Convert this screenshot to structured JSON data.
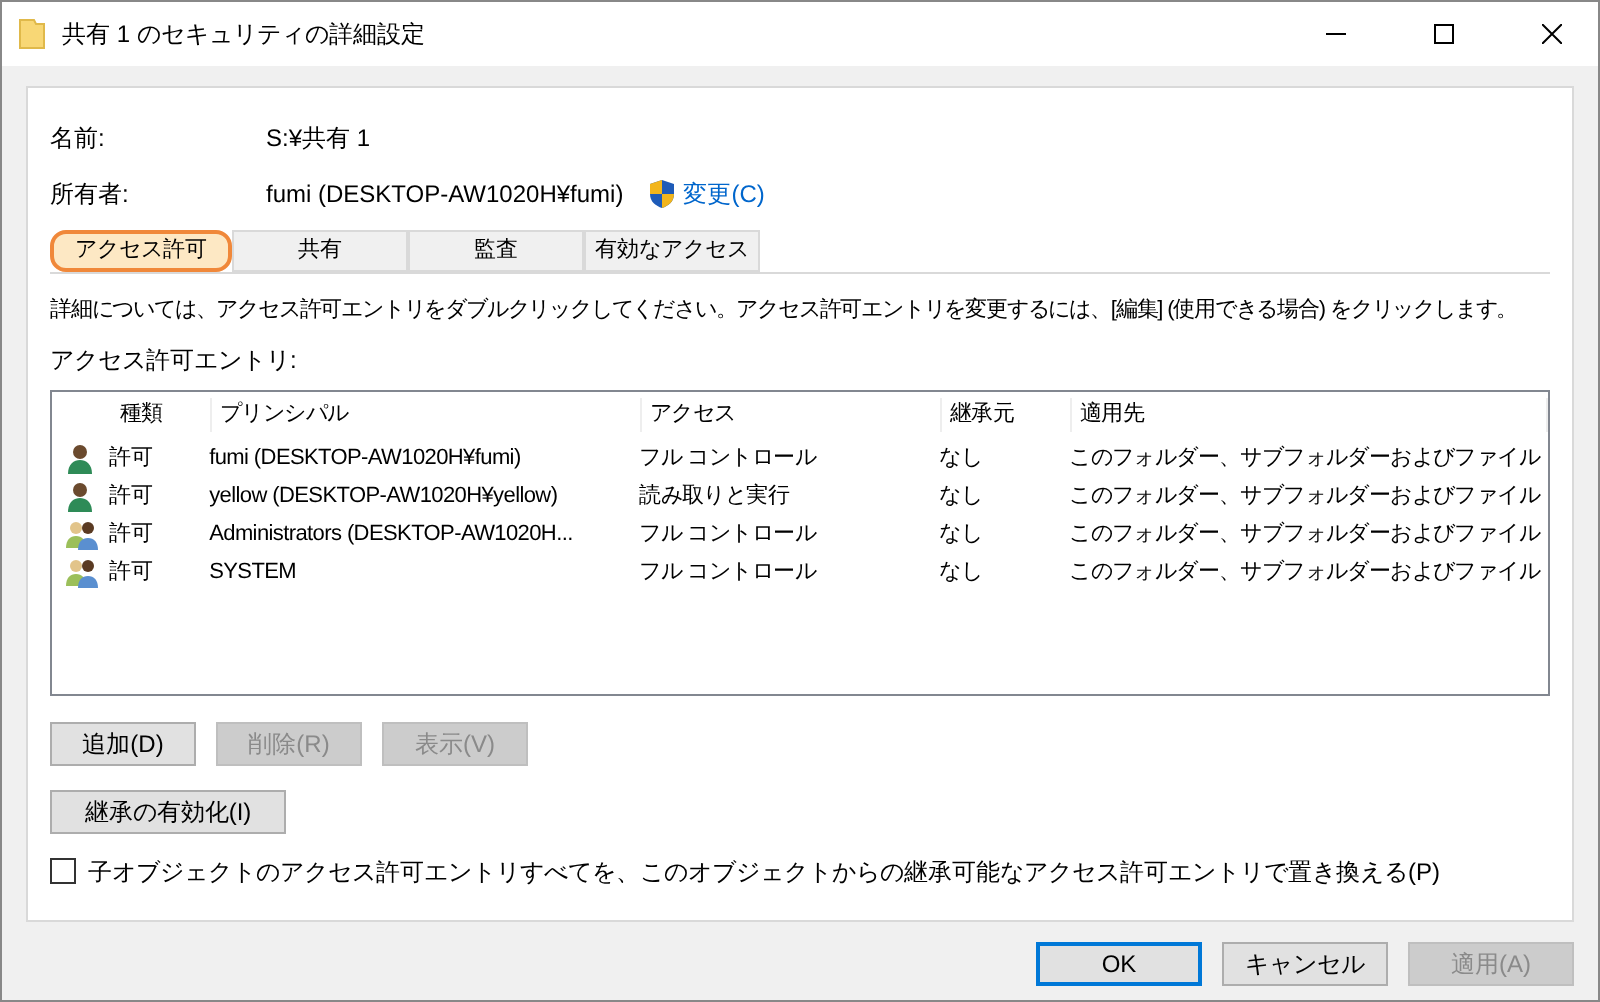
{
  "window": {
    "title": "共有 1 のセキュリティの詳細設定"
  },
  "fields": [
    {
      "label": "名前:",
      "value": "S:¥共有 1"
    },
    {
      "label": "所有者:",
      "value": "fumi (DESKTOP-AW1020H¥fumi)",
      "link": "変更(C)"
    }
  ],
  "tabs": [
    {
      "label": "アクセス許可",
      "selected": true
    },
    {
      "label": "共有",
      "selected": false
    },
    {
      "label": "監査",
      "selected": false
    },
    {
      "label": "有効なアクセス",
      "selected": false
    }
  ],
  "info": "詳細については、アクセス許可エントリをダブルクリックしてください。アクセス許可エントリを変更するには、[編集] (使用できる場合) をクリックします。",
  "entries_label": "アクセス許可エントリ:",
  "table": {
    "columns": [
      "種類",
      "プリンシパル",
      "アクセス",
      "継承元",
      "適用先"
    ],
    "rows": [
      {
        "kind": "user",
        "cells": [
          "許可",
          "fumi (DESKTOP-AW1020H¥fumi)",
          "フル コントロール",
          "なし",
          "このフォルダー、サブフォルダーおよびファイル"
        ]
      },
      {
        "kind": "user",
        "cells": [
          "許可",
          "yellow (DESKTOP-AW1020H¥yellow)",
          "読み取りと実行",
          "なし",
          "このフォルダー、サブフォルダーおよびファイル"
        ]
      },
      {
        "kind": "group",
        "cells": [
          "許可",
          "Administrators (DESKTOP-AW1020H...",
          "フル コントロール",
          "なし",
          "このフォルダー、サブフォルダーおよびファイル"
        ]
      },
      {
        "kind": "group",
        "cells": [
          "許可",
          "SYSTEM",
          "フル コントロール",
          "なし",
          "このフォルダー、サブフォルダーおよびファイル"
        ]
      }
    ]
  },
  "entry_buttons": [
    {
      "label": "追加(D)",
      "disabled": false
    },
    {
      "label": "削除(R)",
      "disabled": true
    },
    {
      "label": "表示(V)",
      "disabled": true
    }
  ],
  "inherit_button": "継承の有効化(I)",
  "replace_checkbox": {
    "label": "子オブジェクトのアクセス許可エントリすべてを、このオブジェクトからの継承可能なアクセス許可エントリで置き換える(P)",
    "checked": false
  },
  "footer_buttons": [
    {
      "label": "OK",
      "disabled": false,
      "default": true
    },
    {
      "label": "キャンセル",
      "disabled": false,
      "default": false
    },
    {
      "label": "適用(A)",
      "disabled": true,
      "default": false
    }
  ]
}
